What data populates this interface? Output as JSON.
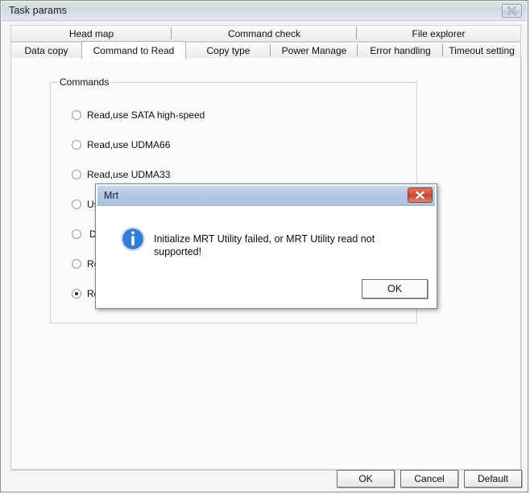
{
  "window": {
    "title": "Task params",
    "close_icon": "close-icon"
  },
  "tabs": {
    "top_row": [
      {
        "label": "Head map",
        "selected": false
      },
      {
        "label": "Command check",
        "selected": false
      },
      {
        "label": "File explorer",
        "selected": false
      }
    ],
    "bottom_row": [
      {
        "label": "Data copy",
        "selected": false
      },
      {
        "label": "Command to Read",
        "selected": true
      },
      {
        "label": "Copy type",
        "selected": false
      },
      {
        "label": "Power Manage",
        "selected": false
      },
      {
        "label": "Error handling",
        "selected": false
      },
      {
        "label": "Timeout setting",
        "selected": false
      }
    ]
  },
  "group": {
    "title": "Commands",
    "options": [
      {
        "label": "Read,use SATA high-speed",
        "selected": false
      },
      {
        "label": "Read,use UDMA66",
        "selected": false
      },
      {
        "label": "Read,use UDMA33",
        "selected": false
      },
      {
        "label": "Use",
        "selected": false
      },
      {
        "label": "Do",
        "selected": false
      },
      {
        "label": "Rea",
        "selected": false
      },
      {
        "label": "Rea",
        "selected": true
      }
    ]
  },
  "footer": {
    "ok": "OK",
    "cancel": "Cancel",
    "default": "Default"
  },
  "dialog": {
    "title": "Mrt",
    "message": "Initialize MRT Utility failed, or MRT Utility read not supported!",
    "ok": "OK",
    "icon": "info-icon",
    "close_icon": "close-icon",
    "titlebar_color": "#b2c9e3",
    "icon_color": "#1f6fd0"
  }
}
